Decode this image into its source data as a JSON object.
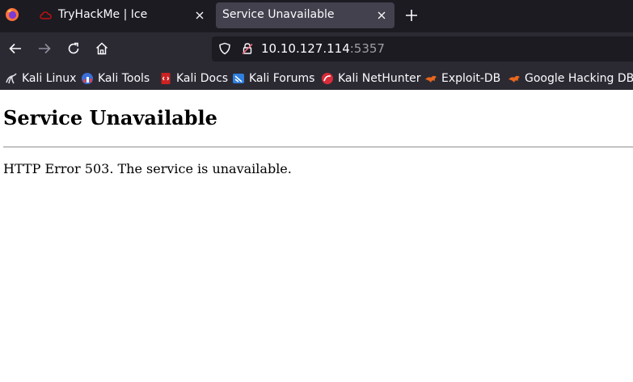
{
  "tabs": [
    {
      "title": "TryHackMe | Ice",
      "active": false
    },
    {
      "title": "Service Unavailable",
      "active": true
    }
  ],
  "url": {
    "host": "10.10.127.114",
    "port": ":5357"
  },
  "bookmarks": [
    {
      "label": "Kali Linux",
      "icon": "kali-dragon-icon"
    },
    {
      "label": "Kali Tools",
      "icon": "kali-tools-icon"
    },
    {
      "label": "Kali Docs",
      "icon": "kali-docs-icon"
    },
    {
      "label": "Kali Forums",
      "icon": "kali-forums-icon"
    },
    {
      "label": "Kali NetHunter",
      "icon": "kali-nethunter-icon"
    },
    {
      "label": "Exploit-DB",
      "icon": "exploit-db-icon"
    },
    {
      "label": "Google Hacking DB",
      "icon": "google-hacking-db-icon"
    }
  ],
  "page": {
    "heading": "Service Unavailable",
    "message": "HTTP Error 503. The service is unavailable."
  },
  "colors": {
    "tabbar": "#1c1b22",
    "toolbar": "#2b2a33",
    "active_tab": "#42414d",
    "firefox_orange": "#ff7139",
    "tryhackme_red": "#c11111",
    "exploit_db_orange": "#e8671c"
  }
}
